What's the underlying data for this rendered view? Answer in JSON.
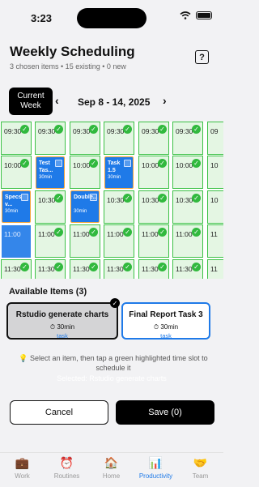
{
  "status": {
    "time": "3:23"
  },
  "header": {
    "title": "Weekly Scheduling",
    "subtitle": "3 chosen items • 15 existing • 0 new",
    "help": "?"
  },
  "week": {
    "current_label": "Current Week",
    "range": "Sep 8 - 14, 2025",
    "prev": "‹",
    "next": "›"
  },
  "grid": {
    "columns": [
      {
        "slots": [
          "09:30",
          "10:00",
          "10:30",
          "",
          "11:30"
        ]
      },
      {
        "slots": [
          "09:30",
          "",
          "10:30",
          "11:00",
          "11:30"
        ]
      },
      {
        "slots": [
          "09:30",
          "10:00",
          "",
          "11:00",
          "11:30"
        ]
      },
      {
        "slots": [
          "09:30",
          "",
          "10:30",
          "11:00",
          "11:30"
        ]
      },
      {
        "slots": [
          "09:30",
          "10:00",
          "10:30",
          "11:00",
          "11:30"
        ]
      },
      {
        "slots": [
          "09:30",
          "10:00",
          "10:30",
          "11:00",
          "11:30"
        ]
      },
      {
        "slots": [
          "09",
          "10",
          "10",
          "11",
          "11"
        ]
      }
    ],
    "selected_slot_time": "11:00",
    "items": [
      {
        "name": "Specs v...",
        "duration": "30min"
      },
      {
        "name": "Test Tas...",
        "duration": "30min"
      },
      {
        "name": "Double...",
        "duration": "30min"
      },
      {
        "name": "Task 1.5",
        "duration": "30min"
      }
    ]
  },
  "available": {
    "title": "Available Items (3)",
    "cards": [
      {
        "title": "Rstudio generate charts",
        "duration": "30min",
        "type": "task"
      },
      {
        "title": "Final Report Task 3",
        "duration": "30min",
        "type": "task"
      }
    ],
    "instruction": "Select an item, then tap a green highlighted time slot to schedule it",
    "selected": "Selected: Rstudio generate charts"
  },
  "actions": {
    "cancel": "Cancel",
    "save": "Save (0)"
  },
  "tabs": [
    {
      "label": "Work",
      "icon": "briefcase-icon"
    },
    {
      "label": "Routines",
      "icon": "alarm-clock-icon"
    },
    {
      "label": "Home",
      "icon": "house-icon"
    },
    {
      "label": "Productivity",
      "icon": "bar-chart-icon"
    },
    {
      "label": "Team",
      "icon": "handshake-icon"
    }
  ],
  "colors": {
    "accent": "#1f7ae8",
    "slot_green": "#3cc146",
    "slot_bg": "#e4f6e3",
    "item_border": "#f3a53a"
  }
}
